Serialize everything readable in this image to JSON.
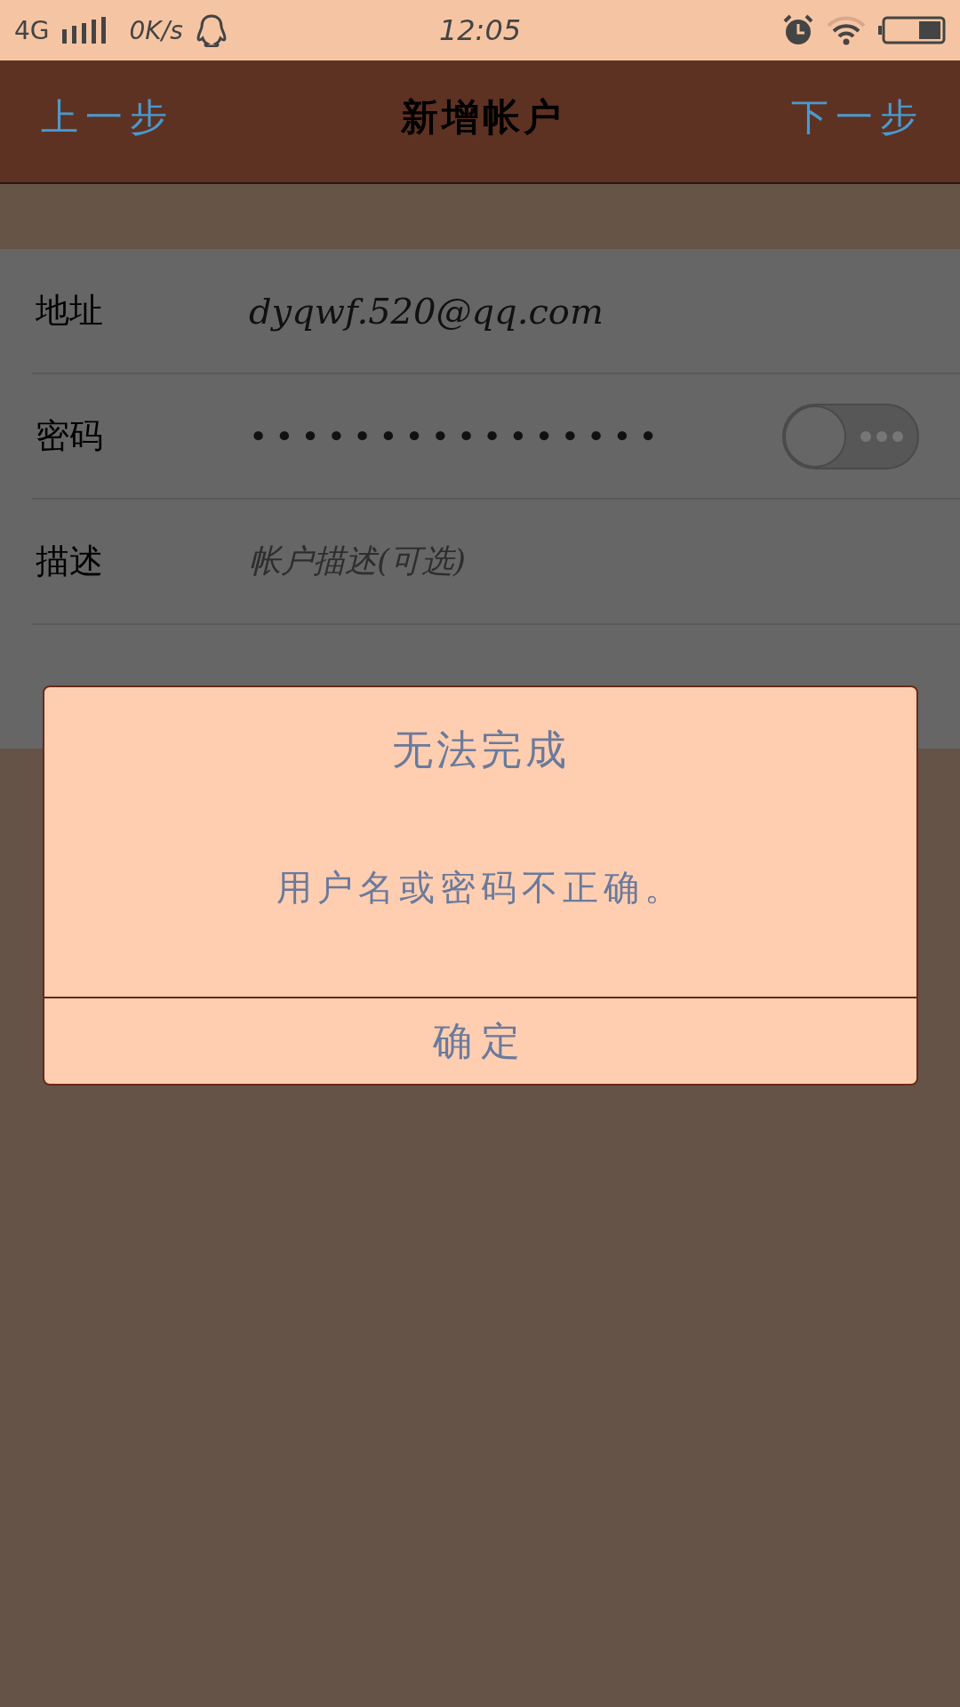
{
  "status_bar": {
    "network": "4G",
    "speed": "0K/s",
    "time": "12:05"
  },
  "nav_bar": {
    "back": "上一步",
    "title": "新增帐户",
    "next": "下一步"
  },
  "form": {
    "rows": [
      {
        "kind": "value",
        "label": "地址",
        "value": "dyqwf.520@qq.com"
      },
      {
        "kind": "password",
        "label": "密码",
        "value": "••••••••••••••••",
        "show_toggle": {
          "on": false
        }
      },
      {
        "kind": "placeholder",
        "label": "描述",
        "placeholder": "帐户描述(可选)"
      }
    ]
  },
  "dialog": {
    "title": "无法完成",
    "message": "用户名或密码不正确。",
    "button": "确定"
  }
}
